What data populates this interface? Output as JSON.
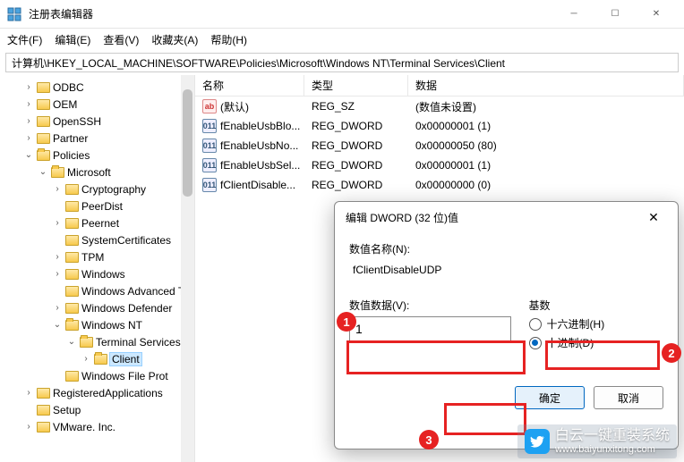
{
  "window": {
    "title": "注册表编辑器"
  },
  "menu": {
    "file": "文件(F)",
    "edit": "编辑(E)",
    "view": "查看(V)",
    "favorites": "收藏夹(A)",
    "help": "帮助(H)"
  },
  "address": "计算机\\HKEY_LOCAL_MACHINE\\SOFTWARE\\Policies\\Microsoft\\Windows NT\\Terminal Services\\Client",
  "tree": {
    "items": [
      {
        "indent": 24,
        "caret": "›",
        "label": "ODBC"
      },
      {
        "indent": 24,
        "caret": "›",
        "label": "OEM"
      },
      {
        "indent": 24,
        "caret": "›",
        "label": "OpenSSH"
      },
      {
        "indent": 24,
        "caret": "›",
        "label": "Partner"
      },
      {
        "indent": 24,
        "caret": "⌄",
        "label": "Policies",
        "open": true
      },
      {
        "indent": 40,
        "caret": "⌄",
        "label": "Microsoft",
        "open": true
      },
      {
        "indent": 56,
        "caret": "›",
        "label": "Cryptography"
      },
      {
        "indent": 56,
        "caret": "",
        "label": "PeerDist"
      },
      {
        "indent": 56,
        "caret": "›",
        "label": "Peernet"
      },
      {
        "indent": 56,
        "caret": "",
        "label": "SystemCertificates"
      },
      {
        "indent": 56,
        "caret": "›",
        "label": "TPM"
      },
      {
        "indent": 56,
        "caret": "›",
        "label": "Windows"
      },
      {
        "indent": 56,
        "caret": "",
        "label": "Windows Advanced T"
      },
      {
        "indent": 56,
        "caret": "›",
        "label": "Windows Defender"
      },
      {
        "indent": 56,
        "caret": "⌄",
        "label": "Windows NT",
        "open": true
      },
      {
        "indent": 72,
        "caret": "⌄",
        "label": "Terminal Services",
        "open": true
      },
      {
        "indent": 88,
        "caret": "›",
        "label": "Client",
        "open": true,
        "selected": true
      },
      {
        "indent": 56,
        "caret": "",
        "label": "Windows File Prot"
      },
      {
        "indent": 24,
        "caret": "›",
        "label": "RegisteredApplications"
      },
      {
        "indent": 24,
        "caret": "",
        "label": "Setup"
      },
      {
        "indent": 24,
        "caret": "›",
        "label": "VMware. Inc."
      }
    ]
  },
  "list": {
    "headers": {
      "name": "名称",
      "type": "类型",
      "data": "数据"
    },
    "rows": [
      {
        "icon": "str",
        "name": "(默认)",
        "type": "REG_SZ",
        "data": "(数值未设置)"
      },
      {
        "icon": "bin",
        "name": "fEnableUsbBlo...",
        "type": "REG_DWORD",
        "data": "0x00000001 (1)"
      },
      {
        "icon": "bin",
        "name": "fEnableUsbNo...",
        "type": "REG_DWORD",
        "data": "0x00000050 (80)"
      },
      {
        "icon": "bin",
        "name": "fEnableUsbSel...",
        "type": "REG_DWORD",
        "data": "0x00000001 (1)"
      },
      {
        "icon": "bin",
        "name": "fClientDisable...",
        "type": "REG_DWORD",
        "data": "0x00000000 (0)"
      }
    ]
  },
  "dialog": {
    "title": "编辑 DWORD (32 位)值",
    "name_label": "数值名称(N):",
    "name_value": "fClientDisableUDP",
    "data_label": "数值数据(V):",
    "data_value": "1",
    "base_label": "基数",
    "radio_hex": "十六进制(H)",
    "radio_dec": "十进制(D)",
    "ok": "确定",
    "cancel": "取消"
  },
  "annotations": {
    "n1": "1",
    "n2": "2",
    "n3": "3"
  },
  "watermark": {
    "text": "白云一键重装系统",
    "url": "www.baiyunxitong.com"
  }
}
